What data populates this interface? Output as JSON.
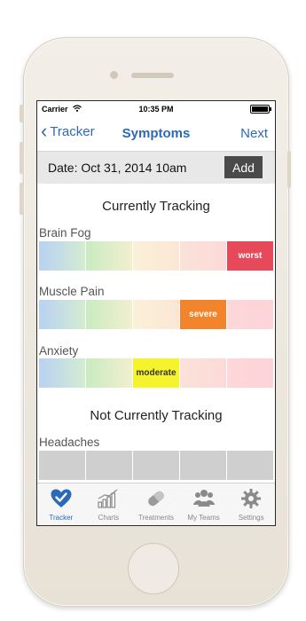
{
  "status": {
    "carrier": "Carrier",
    "time": "10:35 PM"
  },
  "nav": {
    "back_label": "Tracker",
    "title": "Symptoms",
    "next_label": "Next"
  },
  "datebar": {
    "date_text": "Date: Oct 31, 2014 10am",
    "add_label": "Add"
  },
  "tracking": {
    "title": "Currently Tracking",
    "symptoms": [
      {
        "name": "Brain Fog",
        "selected_index": 4,
        "selected_label": "worst",
        "selected_color": "#e64a5a",
        "selected_text_color": "#ffffff"
      },
      {
        "name": "Muscle Pain",
        "selected_index": 3,
        "selected_label": "severe",
        "selected_color": "#f2842c",
        "selected_text_color": "#ffffff"
      },
      {
        "name": "Anxiety",
        "selected_index": 2,
        "selected_label": "moderate",
        "selected_color": "#f5f32b",
        "selected_text_color": "#333333"
      }
    ]
  },
  "not_tracking": {
    "title": "Not Currently Tracking",
    "symptoms": [
      {
        "name": "Headaches"
      }
    ]
  },
  "tabbar": {
    "tabs": [
      {
        "label": "Tracker",
        "icon": "heart-check-icon",
        "active": true
      },
      {
        "label": "Charts",
        "icon": "bar-chart-icon",
        "active": false
      },
      {
        "label": "Treatments",
        "icon": "pill-icon",
        "active": false
      },
      {
        "label": "My Teams",
        "icon": "team-icon",
        "active": false
      },
      {
        "label": "Settings",
        "icon": "gear-icon",
        "active": false
      }
    ],
    "active_color": "#2b6ab8",
    "inactive_color": "#8a8a8a"
  }
}
